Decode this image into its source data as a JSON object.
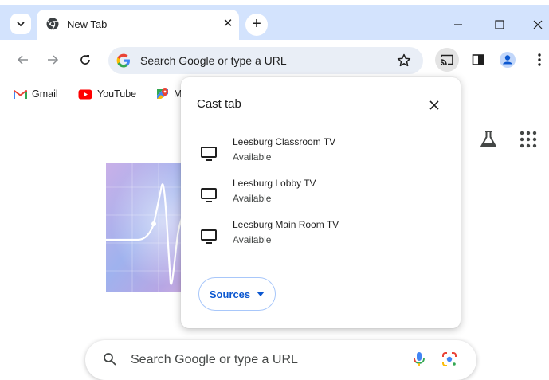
{
  "tab": {
    "title": "New Tab"
  },
  "omnibox": {
    "placeholder": "Search Google or type a URL"
  },
  "bookmarks": [
    {
      "label": "Gmail"
    },
    {
      "label": "YouTube"
    },
    {
      "label": "M"
    }
  ],
  "ntp": {
    "search_placeholder": "Search Google or type a URL"
  },
  "cast_dialog": {
    "title": "Cast tab",
    "sinks": [
      {
        "name": "Leesburg Classroom TV",
        "status": "Available"
      },
      {
        "name": "Leesburg Lobby TV",
        "status": "Available"
      },
      {
        "name": "Leesburg Main Room TV",
        "status": "Available"
      }
    ],
    "sources_label": "Sources"
  },
  "colors": {
    "tabstrip": "#d3e3fd",
    "omnibox": "#e9eef6",
    "accent": "#0b57d0",
    "profile": "#0b57d0"
  }
}
